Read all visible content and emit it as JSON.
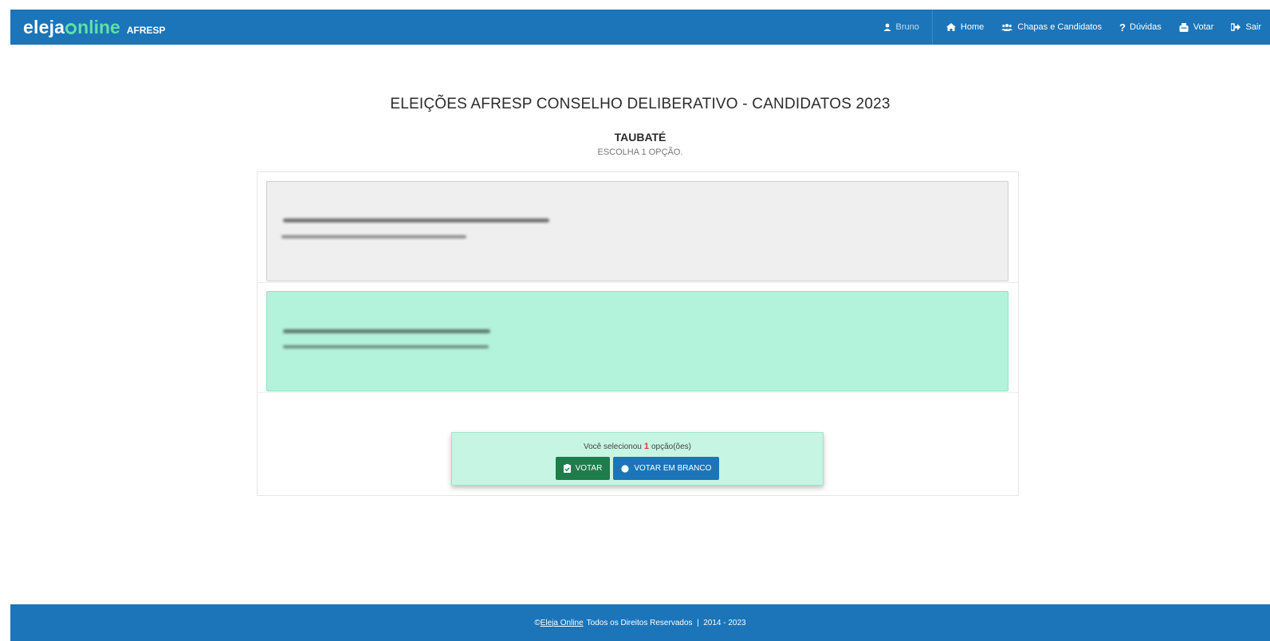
{
  "header": {
    "brand_left": "eleja",
    "brand_right": "nline",
    "brand_tag": "AFRESP",
    "user": "Bruno",
    "nav": [
      {
        "label": "Home",
        "icon": "home-icon"
      },
      {
        "label": "Chapas e Candidatos",
        "icon": "users-icon"
      },
      {
        "label": "Dúvidas",
        "icon": "question-icon"
      },
      {
        "label": "Votar",
        "icon": "ballot-box-icon"
      },
      {
        "label": "Sair",
        "icon": "sign-out-icon"
      }
    ]
  },
  "main": {
    "title": "ELEIÇÕES AFRESP CONSELHO DELIBERATIVO - CANDIDATOS 2023",
    "subtitle": "TAUBATÉ",
    "instruction": "ESCOLHA 1 OPÇÃO.",
    "options": [
      {
        "state": "unselected",
        "color": "#efefef"
      },
      {
        "state": "selected",
        "color": "#b3f3dc"
      }
    ],
    "summary": {
      "text_before": "Você selecionou",
      "count": "1",
      "text_after": "opção(ões)",
      "vote_label": "VOTAR",
      "blank_label": "VOTAR EM BRANCO"
    }
  },
  "footer": {
    "copyright_symbol": "©",
    "link": "Eleja Online",
    "text": "Todos os Direitos Reservados  |  2014 - 2023"
  },
  "colors": {
    "primary": "#1b75b8",
    "accent": "#5fe0a7",
    "selected_option": "#b3f3dc",
    "vote_button": "#1e7d4b",
    "count": "#e03a2f"
  }
}
